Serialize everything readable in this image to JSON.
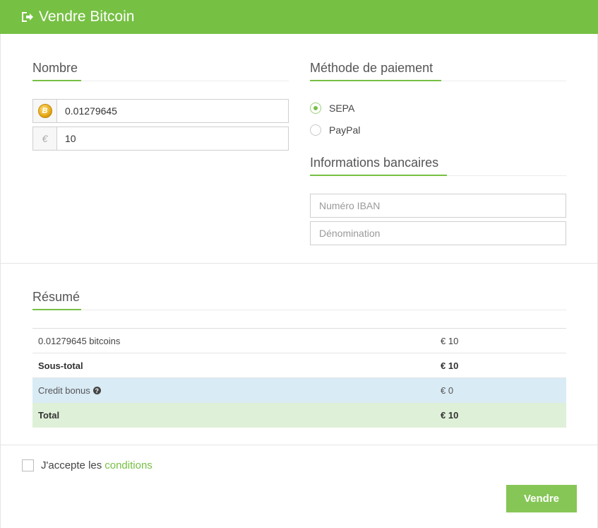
{
  "header": {
    "title": "Vendre Bitcoin",
    "icon": "sign-out-icon",
    "color": "#76c043"
  },
  "amount": {
    "title": "Nombre",
    "btc_value": "0.01279645",
    "btc_icon": "bitcoin-coin-icon",
    "eur_symbol": "€",
    "eur_value": "10"
  },
  "payment": {
    "title": "Méthode de paiement",
    "options": [
      {
        "label": "SEPA",
        "checked": true
      },
      {
        "label": "PayPal",
        "checked": false
      }
    ]
  },
  "bank": {
    "title": "Informations bancaires",
    "iban_placeholder": "Numéro IBAN",
    "name_placeholder": "Dénomination"
  },
  "summary": {
    "title": "Résumé",
    "rows": [
      {
        "label": "0.01279645 bitcoins",
        "amount": "€ 10"
      },
      {
        "label": "Sous-total",
        "amount": "€ 10"
      },
      {
        "label": "Credit bonus",
        "amount": "€ 0"
      },
      {
        "label": "Total",
        "amount": "€ 10"
      }
    ]
  },
  "terms": {
    "text": "J'accepte les",
    "link": "conditions",
    "checked": false
  },
  "submit": {
    "label": "Vendre"
  }
}
